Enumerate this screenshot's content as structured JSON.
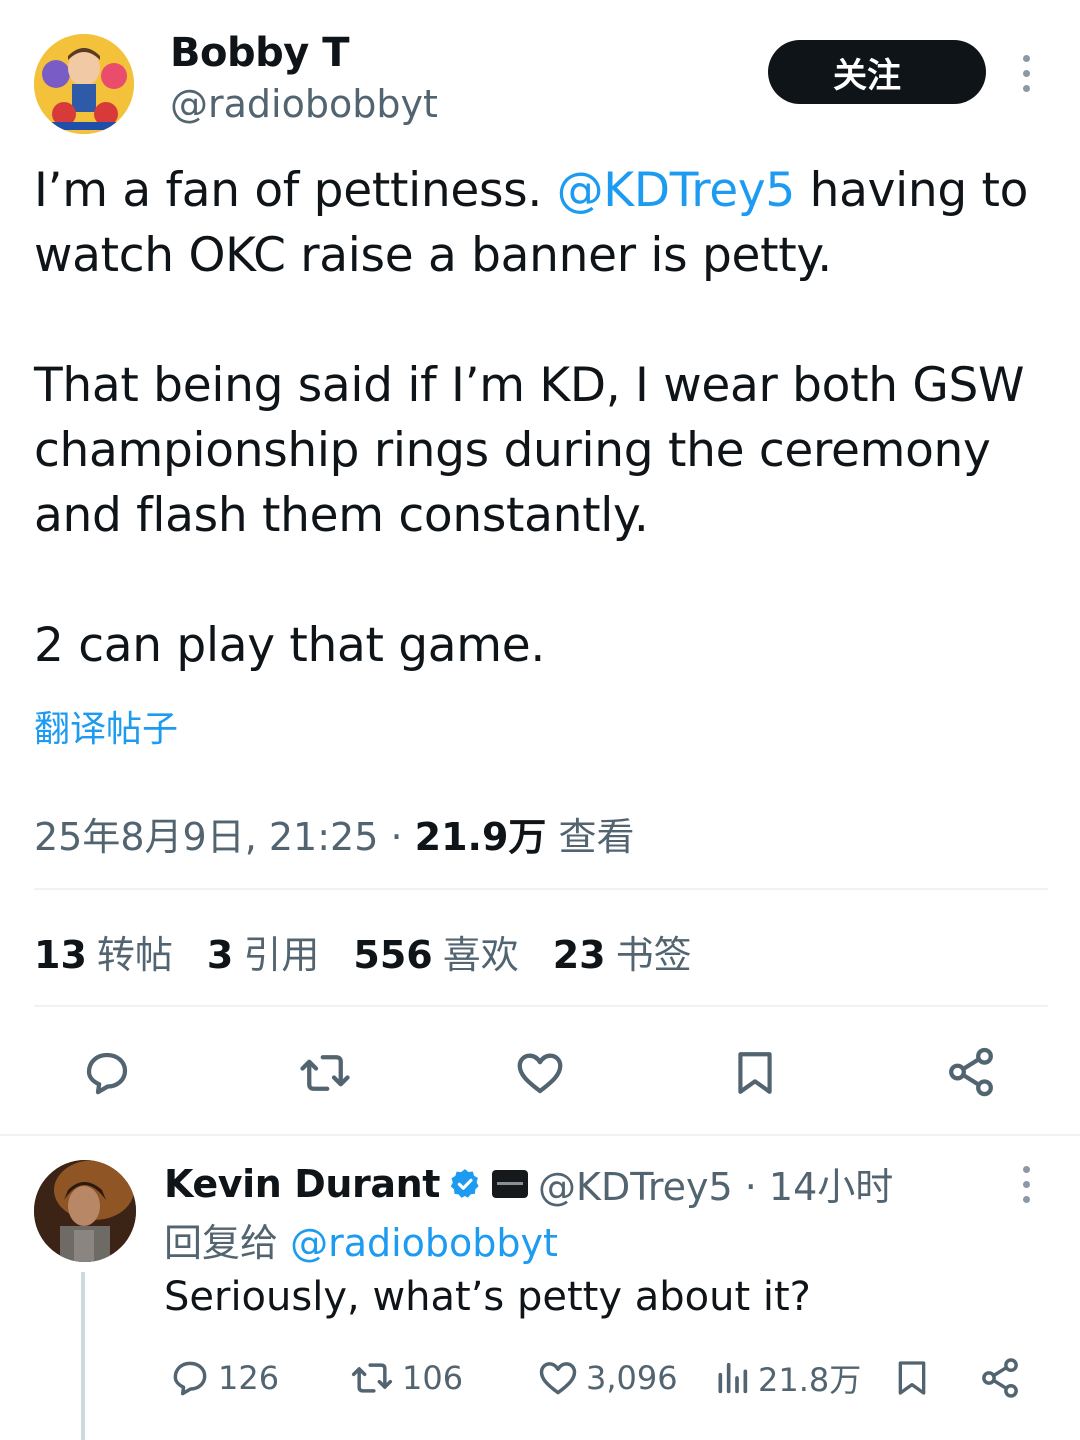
{
  "main_tweet": {
    "author": {
      "display_name": "Bobby T",
      "handle": "@radiobobbyt"
    },
    "follow_label": "关注",
    "text_lines": [
      {
        "before": "I’m a fan of pettiness. ",
        "mention": "@KDTrey5",
        "after": " having to"
      },
      {
        "text": "watch OKC raise a banner is petty."
      },
      {
        "text": "That being said if I’m KD, I wear both GSW"
      },
      {
        "text": "championship rings during the ceremony"
      },
      {
        "text": "and flash them constantly."
      },
      {
        "text": "2 can play that game."
      }
    ],
    "translate_label": "翻译帖子",
    "timestamp": "25年8月9日, 21:25 · ",
    "views_count": "21.9万",
    "views_label": " 查看",
    "stats": [
      {
        "num": "13",
        "label": "转帖"
      },
      {
        "num": "3",
        "label": "引用"
      },
      {
        "num": "556",
        "label": "喜欢"
      },
      {
        "num": "23",
        "label": "书签"
      }
    ],
    "actions": [
      "reply-icon",
      "retweet-icon",
      "like-icon",
      "bookmark-icon",
      "share-icon"
    ]
  },
  "reply": {
    "display_name": "Kevin Durant",
    "verified": true,
    "handle_time": "@KDTrey5 · 14小时",
    "replying_prefix": "回复给 ",
    "replying_to": "@radiobobbyt",
    "text": "Seriously, what’s petty about it?",
    "actions": {
      "replies": "126",
      "retweets": "106",
      "likes": "3,096",
      "views": "21.8万"
    }
  },
  "colors": {
    "accent": "#1d9bf0",
    "secondary_text": "#536471",
    "primary_text": "#0f1419",
    "divider": "#eff3f4"
  }
}
